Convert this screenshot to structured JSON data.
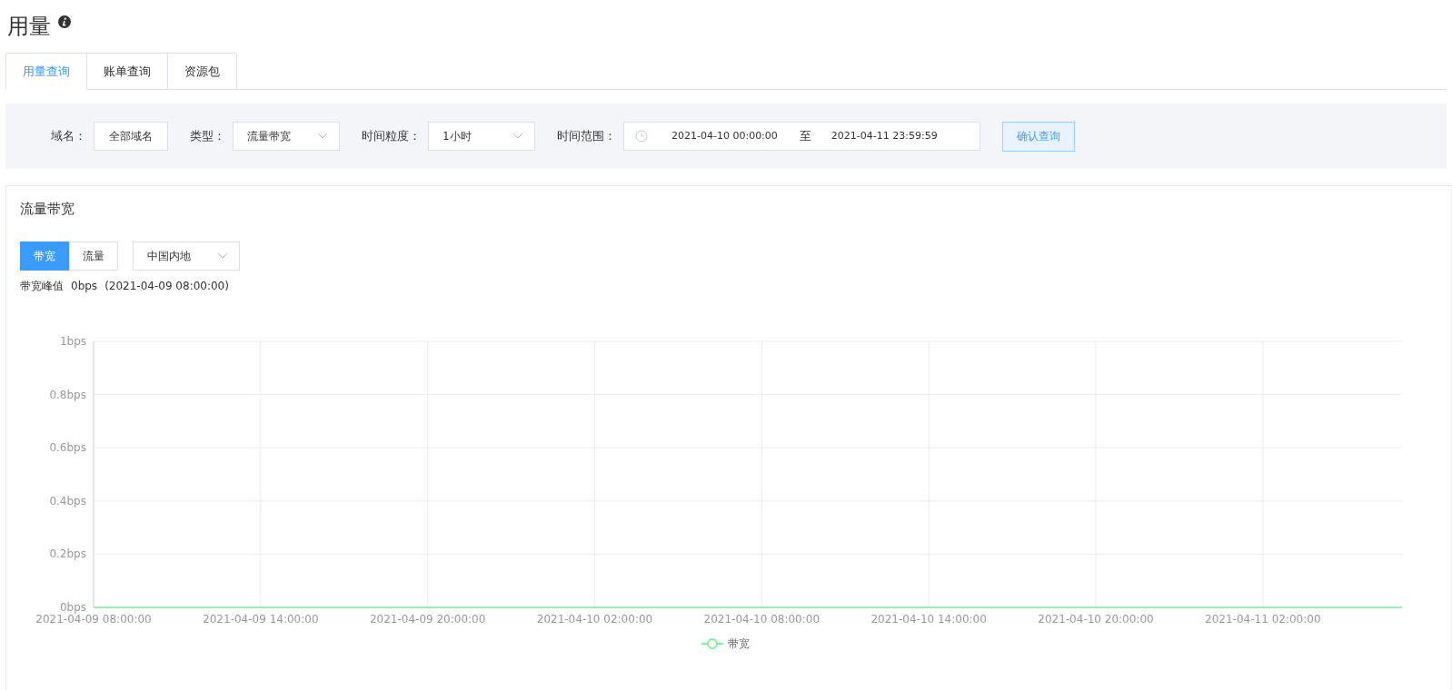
{
  "page": {
    "title": "用量"
  },
  "tabs": [
    {
      "label": "用量查询",
      "selected": true
    },
    {
      "label": "账单查询",
      "selected": false
    },
    {
      "label": "资源包",
      "selected": false
    }
  ],
  "filters": {
    "domain_label": "域名：",
    "domain_value": "全部域名",
    "type_label": "类型：",
    "type_value": "流量带宽",
    "granularity_label": "时间粒度：",
    "granularity_value": "1小时",
    "range_label": "时间范围：",
    "range_start": "2021-04-10 00:00:00",
    "range_separator": "至",
    "range_end": "2021-04-11 23:59:59",
    "submit": "确认查询"
  },
  "panel": {
    "title": "流量带宽",
    "modes": [
      {
        "label": "带宽",
        "selected": true
      },
      {
        "label": "流量",
        "selected": false
      }
    ],
    "region": "中国内地",
    "peak_label": "带宽峰值",
    "peak_value": "0bps",
    "peak_time": "(2021-04-09 08:00:00)",
    "chart_data": {
      "type": "line",
      "categories": [
        "2021-04-09 08:00:00",
        null,
        null,
        null,
        null,
        null,
        "2021-04-09 14:00:00",
        null,
        null,
        null,
        null,
        null,
        "2021-04-09 20:00:00",
        null,
        null,
        null,
        null,
        null,
        "2021-04-10 02:00:00",
        null,
        null,
        null,
        null,
        null,
        "2021-04-10 08:00:00",
        null,
        null,
        null,
        null,
        null,
        "2021-04-10 14:00:00",
        null,
        null,
        null,
        null,
        null,
        "2021-04-10 20:00:00",
        null,
        null,
        null,
        null,
        null,
        "2021-04-11 02:00:00",
        null,
        null,
        null,
        null,
        null
      ],
      "series": [
        {
          "name": "带宽",
          "color": "#7cf59e",
          "values": [
            0,
            0,
            0,
            0,
            0,
            0,
            0,
            0,
            0,
            0,
            0,
            0,
            0,
            0,
            0,
            0,
            0,
            0,
            0,
            0,
            0,
            0,
            0,
            0,
            0,
            0,
            0,
            0,
            0,
            0,
            0,
            0,
            0,
            0,
            0,
            0,
            0,
            0,
            0,
            0,
            0,
            0,
            0,
            0,
            0,
            0,
            0,
            0
          ]
        }
      ],
      "ylim": [
        0,
        1
      ],
      "grid": true,
      "yticks": [
        {
          "value": 0,
          "label": "0bps"
        },
        {
          "value": 0.2,
          "label": "0.2bps"
        },
        {
          "value": 0.4,
          "label": "0.4bps"
        },
        {
          "value": 0.6,
          "label": "0.6bps"
        },
        {
          "value": 0.8,
          "label": "0.8bps"
        },
        {
          "value": 1,
          "label": "1bps"
        }
      ]
    }
  }
}
